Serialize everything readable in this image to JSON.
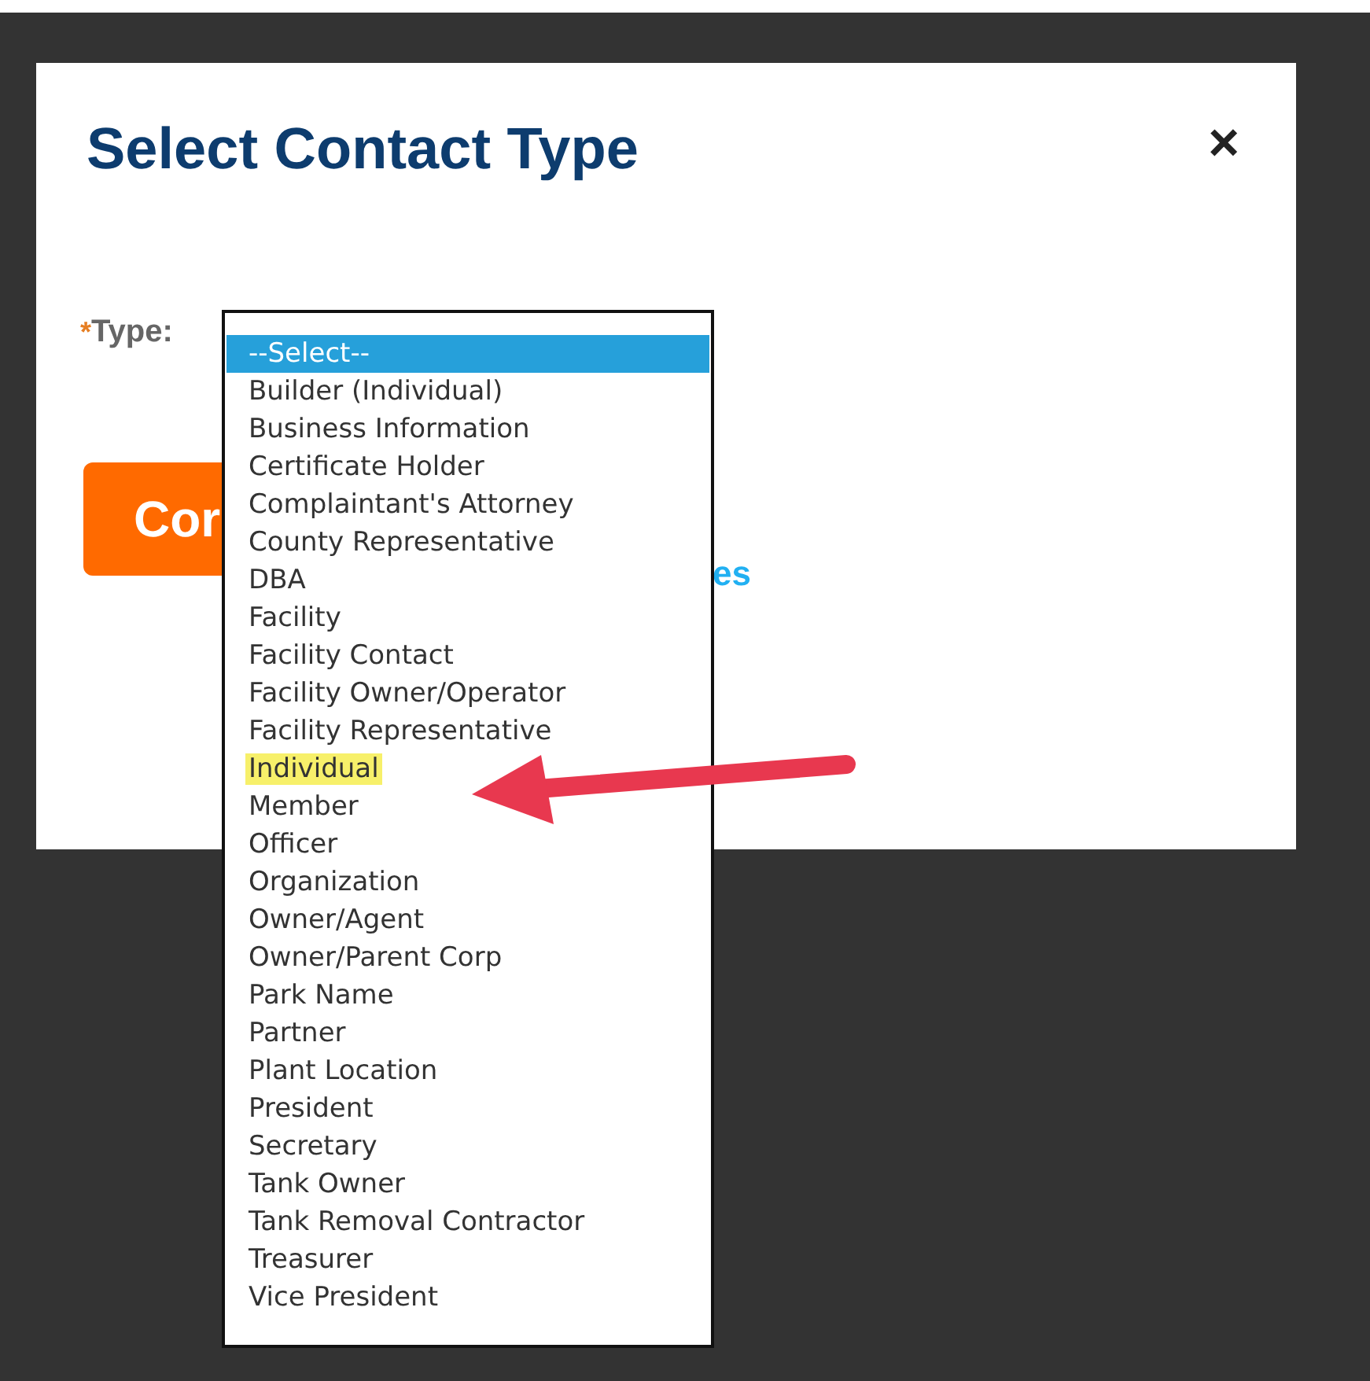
{
  "dialog": {
    "title": "Select Contact Type",
    "close": "×"
  },
  "type_field": {
    "required_mark": "*",
    "label": "Type:"
  },
  "continue_button": {
    "label": "Cor"
  },
  "link": {
    "label": "es"
  },
  "dropdown": {
    "options": [
      {
        "label": "--Select--",
        "selected": true,
        "highlighted": false
      },
      {
        "label": "Builder (Individual)",
        "selected": false,
        "highlighted": false
      },
      {
        "label": "Business Information",
        "selected": false,
        "highlighted": false
      },
      {
        "label": "Certificate Holder",
        "selected": false,
        "highlighted": false
      },
      {
        "label": "Complaintant's Attorney",
        "selected": false,
        "highlighted": false
      },
      {
        "label": "County Representative",
        "selected": false,
        "highlighted": false
      },
      {
        "label": "DBA",
        "selected": false,
        "highlighted": false
      },
      {
        "label": "Facility",
        "selected": false,
        "highlighted": false
      },
      {
        "label": "Facility Contact",
        "selected": false,
        "highlighted": false
      },
      {
        "label": "Facility Owner/Operator",
        "selected": false,
        "highlighted": false
      },
      {
        "label": "Facility Representative",
        "selected": false,
        "highlighted": false
      },
      {
        "label": "Individual",
        "selected": false,
        "highlighted": true
      },
      {
        "label": "Member",
        "selected": false,
        "highlighted": false
      },
      {
        "label": "Officer",
        "selected": false,
        "highlighted": false
      },
      {
        "label": "Organization",
        "selected": false,
        "highlighted": false
      },
      {
        "label": "Owner/Agent",
        "selected": false,
        "highlighted": false
      },
      {
        "label": "Owner/Parent Corp",
        "selected": false,
        "highlighted": false
      },
      {
        "label": "Park Name",
        "selected": false,
        "highlighted": false
      },
      {
        "label": "Partner",
        "selected": false,
        "highlighted": false
      },
      {
        "label": "Plant Location",
        "selected": false,
        "highlighted": false
      },
      {
        "label": "President",
        "selected": false,
        "highlighted": false
      },
      {
        "label": "Secretary",
        "selected": false,
        "highlighted": false
      },
      {
        "label": "Tank Owner",
        "selected": false,
        "highlighted": false
      },
      {
        "label": "Tank Removal Contractor",
        "selected": false,
        "highlighted": false
      },
      {
        "label": "Treasurer",
        "selected": false,
        "highlighted": false
      },
      {
        "label": "Vice President",
        "selected": false,
        "highlighted": false
      }
    ]
  }
}
